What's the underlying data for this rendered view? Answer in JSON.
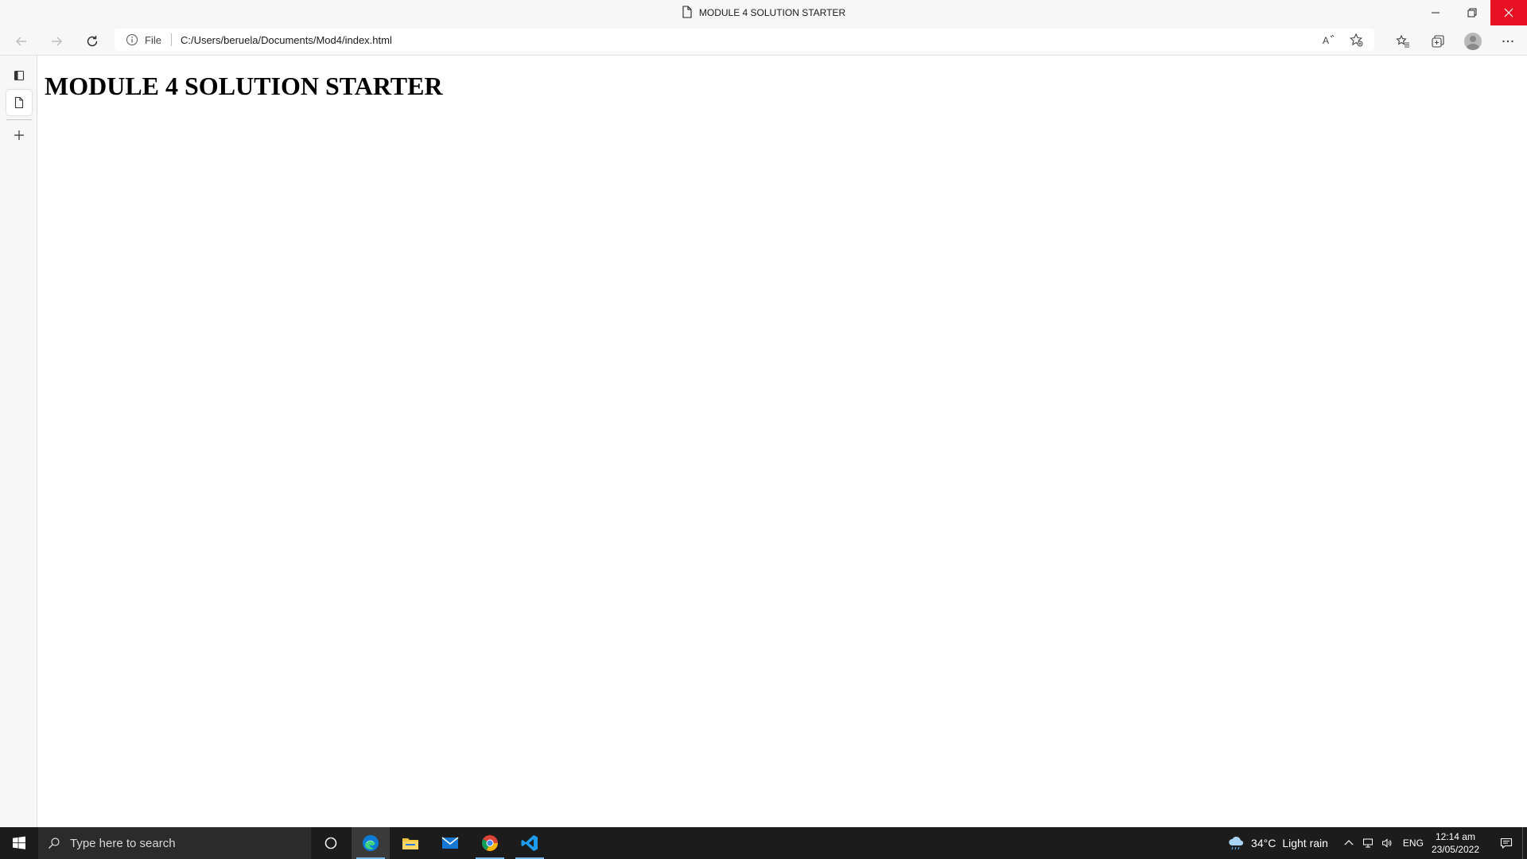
{
  "window": {
    "title": "MODULE 4 SOLUTION STARTER",
    "icons": {
      "page": "page-icon",
      "minimize": "minimize-icon",
      "restore": "restore-icon",
      "close": "close-icon"
    },
    "close_color": "#e81123"
  },
  "toolbar": {
    "icons": [
      "back-arrow-icon",
      "forward-arrow-icon",
      "refresh-icon",
      "info-icon",
      "read-aloud-icon",
      "add-favorite-icon",
      "favorites-icon",
      "collections-icon",
      "profile-icon",
      "more-icon"
    ]
  },
  "addressbar": {
    "scheme_label": "File",
    "url": "C:/Users/beruela/Documents/Mod4/index.html"
  },
  "sidebar": {
    "icons": [
      "tab-actions-icon",
      "page-icon",
      "new-tab-icon"
    ]
  },
  "page": {
    "heading": "MODULE 4 SOLUTION STARTER"
  },
  "taskbar": {
    "search_placeholder": "Type here to search",
    "apps": [
      "task-view-icon",
      "edge-icon",
      "file-explorer-icon",
      "mail-icon",
      "chrome-icon",
      "vscode-icon"
    ],
    "active_underline_color": "#76b9ed",
    "weather": {
      "temperature": "34°C",
      "condition": "Light rain"
    },
    "language": "ENG",
    "time": "12:14 am",
    "date": "23/05/2022"
  }
}
